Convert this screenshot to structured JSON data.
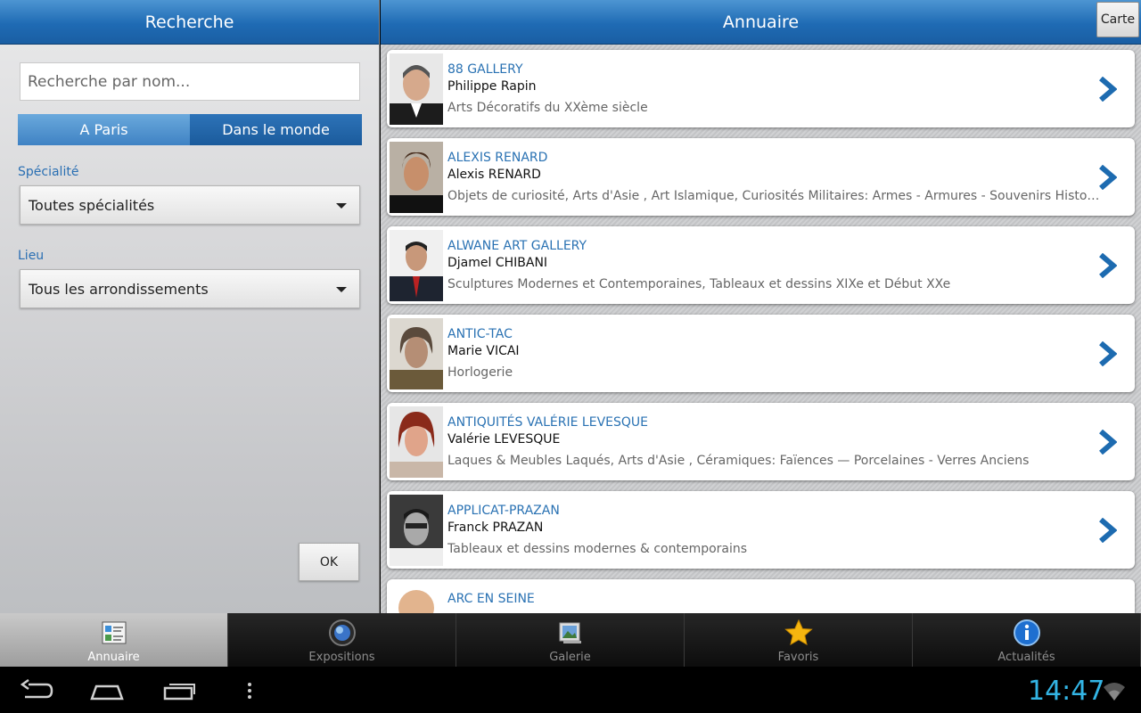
{
  "left_panel": {
    "title": "Recherche",
    "search_placeholder": "Recherche par nom...",
    "segments": [
      "A Paris",
      "Dans le monde"
    ],
    "specialite_label": "Spécialité",
    "specialite_value": "Toutes spécialités",
    "lieu_label": "Lieu",
    "lieu_value": "Tous les arrondissements",
    "ok_label": "OK"
  },
  "right_panel": {
    "title": "Annuaire",
    "map_button": "Carte",
    "entries": [
      {
        "gallery": "88 GALLERY",
        "person": "Philippe Rapin",
        "specialty": "Arts Décoratifs du XXème siècle"
      },
      {
        "gallery": "ALEXIS RENARD",
        "person": "Alexis RENARD",
        "specialty": "Objets de curiosité, Arts d'Asie , Art Islamique, Curiosités  Militaires: Armes - Armures - Souvenirs  Historiques - Décorations"
      },
      {
        "gallery": "ALWANE ART GALLERY",
        "person": "Djamel CHIBANI",
        "specialty": "Sculptures Modernes et Contemporaines, Tableaux et dessins XIXe et Début XXe"
      },
      {
        "gallery": "ANTIC-TAC",
        "person": "Marie VICAI",
        "specialty": "Horlogerie"
      },
      {
        "gallery": "ANTIQUITÉS VALÉRIE LEVESQUE",
        "person": "Valérie LEVESQUE",
        "specialty": "Laques & Meubles Laqués, Arts d'Asie , Céramiques: Faïences — Porcelaines - Verres Anciens"
      },
      {
        "gallery": "APPLICAT-PRAZAN",
        "person": "Franck PRAZAN",
        "specialty": "Tableaux et dessins modernes & contemporains"
      },
      {
        "gallery": "ARC EN SEINE",
        "person": "",
        "specialty": ""
      }
    ]
  },
  "tabs": [
    {
      "label": "Annuaire",
      "icon": "directory-icon",
      "active": true
    },
    {
      "label": "Expositions",
      "icon": "globe-icon",
      "active": false
    },
    {
      "label": "Galerie",
      "icon": "gallery-icon",
      "active": false
    },
    {
      "label": "Favoris",
      "icon": "star-icon",
      "active": false
    },
    {
      "label": "Actualités",
      "icon": "info-icon",
      "active": false
    }
  ],
  "system_bar": {
    "clock": "14:47",
    "accent_color": "#33b5e5"
  }
}
